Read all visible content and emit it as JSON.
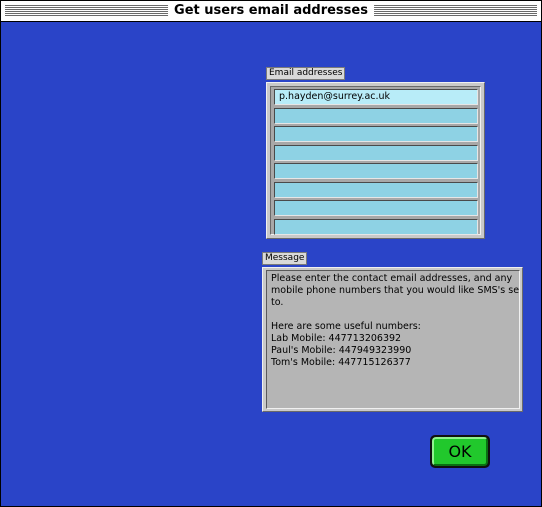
{
  "window": {
    "title": "Get users email addresses"
  },
  "email_section": {
    "label": "Email addresses",
    "rows": [
      "p.hayden@surrey.ac.uk",
      "",
      "",
      "",
      "",
      "",
      "",
      ""
    ]
  },
  "message_section": {
    "label": "Message",
    "lines": [
      "Please enter the contact email addresses, and any",
      "mobile phone numbers that you would like SMS's sent",
      "to.",
      "",
      "Here are some useful numbers:",
      "Lab Mobile:  447713206392",
      "Paul's Mobile:  447949323990",
      "Tom's Mobile:  447715126377"
    ]
  },
  "buttons": {
    "ok_label": "OK"
  },
  "colors": {
    "background": "#2a44c8",
    "email_row": "#8ed2e4",
    "ok_button": "#21c82c"
  }
}
